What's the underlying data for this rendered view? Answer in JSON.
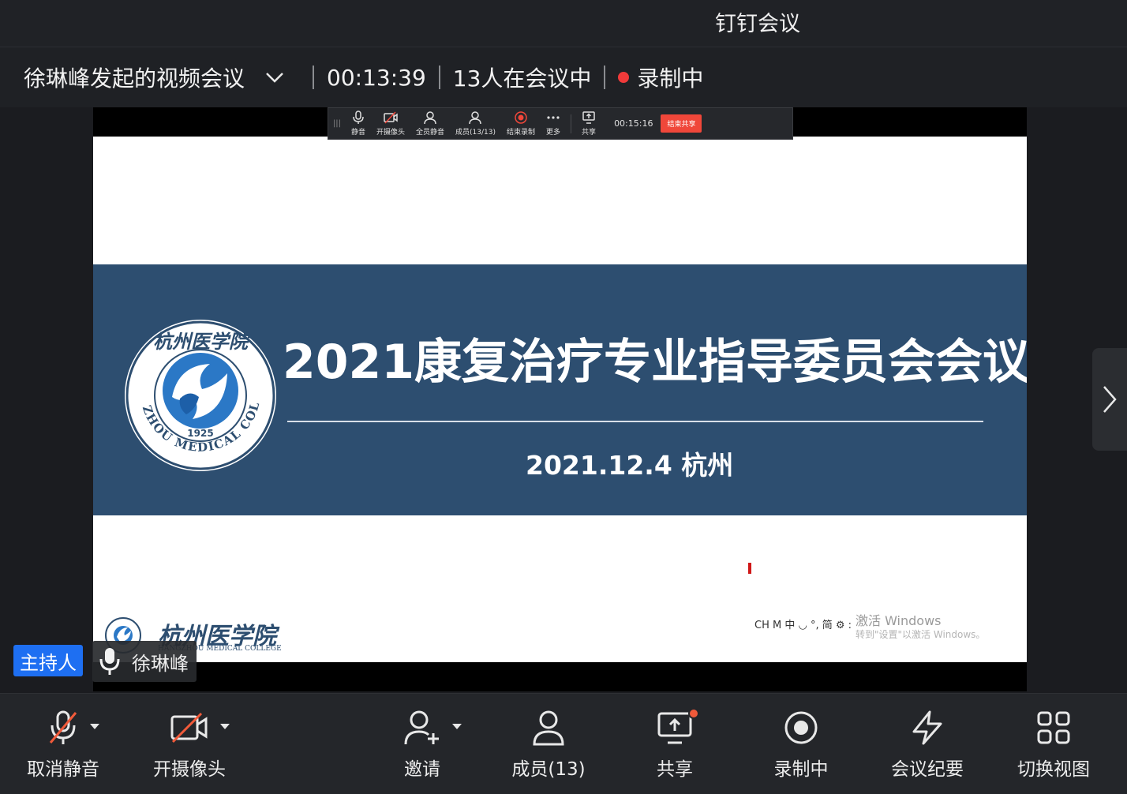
{
  "app_title": "钉钉会议",
  "meeting": {
    "name": "徐琳峰发起的视频会议",
    "elapsed": "00:13:39",
    "participants_text": "13人在会议中",
    "recording_text": "录制中"
  },
  "mini_toolbar": {
    "items": [
      {
        "label": "静音"
      },
      {
        "label": "开摄像头"
      },
      {
        "label": "全员静音"
      },
      {
        "label": "成员(13/13)"
      },
      {
        "label": "结束录制"
      },
      {
        "label": "更多"
      },
      {
        "label": "共享"
      }
    ],
    "time": "00:15:16",
    "end_share_label": "结束共享"
  },
  "slide": {
    "title": "2021康复治疗专业指导委员会会议",
    "date_location": "2021.12.4  杭州",
    "logo_year": "1925",
    "logo_ring_text": "HANGZHOU MEDICAL COLLEGE",
    "footer_logo_cn": "杭州医学院",
    "footer_logo_en": "HANGZHOU MEDICAL COLLEGE",
    "ime_text": "CH  M  中  ◡  °,  简  ⚙  :",
    "watermark_line1": "激活 Windows",
    "watermark_line2": "转到\"设置\"以激活 Windows。"
  },
  "speaker": {
    "host_badge": "主持人",
    "name": "徐琳峰"
  },
  "bottom_toolbar": {
    "unmute": "取消静音",
    "camera": "开摄像头",
    "invite": "邀请",
    "members": "成员(13)",
    "share": "共享",
    "recording": "录制中",
    "minutes": "会议纪要",
    "switch_view": "切换视图"
  },
  "colors": {
    "accent_blue": "#1e6ff2",
    "recording_red": "#f03a3a",
    "slide_banner": "#2d4e70"
  }
}
